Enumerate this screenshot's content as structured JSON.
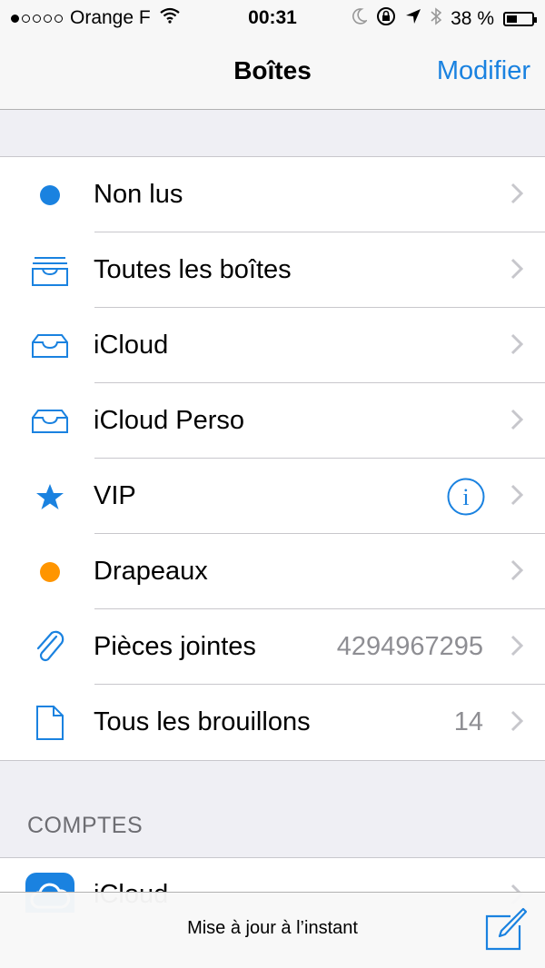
{
  "status_bar": {
    "carrier": "Orange F",
    "time": "00:31",
    "battery": "38 %",
    "battery_level": 0.38,
    "signal_bars_filled": 1,
    "signal_bars_total": 5
  },
  "nav": {
    "title": "Boîtes",
    "edit_label": "Modifier"
  },
  "mailboxes": [
    {
      "label": "Non lus",
      "icon": "unread-dot-icon",
      "color": "#1a82e0"
    },
    {
      "label": "Toutes les boîtes",
      "icon": "all-inboxes-icon",
      "color": "#1a82e0"
    },
    {
      "label": "iCloud",
      "icon": "inbox-tray-icon",
      "color": "#1a82e0"
    },
    {
      "label": "iCloud Perso",
      "icon": "inbox-tray-icon",
      "color": "#1a82e0"
    },
    {
      "label": "VIP",
      "icon": "star-icon",
      "color": "#1a82e0",
      "info_button": true
    },
    {
      "label": "Drapeaux",
      "icon": "flag-dot-icon",
      "color": "#ff9500"
    },
    {
      "label": "Pièces jointes",
      "icon": "paperclip-icon",
      "color": "#1a82e0",
      "count": "4294967295"
    },
    {
      "label": "Tous les brouillons",
      "icon": "draft-document-icon",
      "color": "#1a82e0",
      "count": "14"
    }
  ],
  "accounts_section": {
    "header": "COMPTES",
    "items": [
      {
        "label": "iCloud",
        "icon": "icloud-icon"
      }
    ]
  },
  "toolbar": {
    "status_text": "Mise à jour à l’instant",
    "compose_icon": "compose-icon"
  },
  "colors": {
    "accent": "#1a82e0",
    "flag": "#ff9500",
    "secondary_text": "#8e8e93",
    "background": "#efeff4"
  }
}
